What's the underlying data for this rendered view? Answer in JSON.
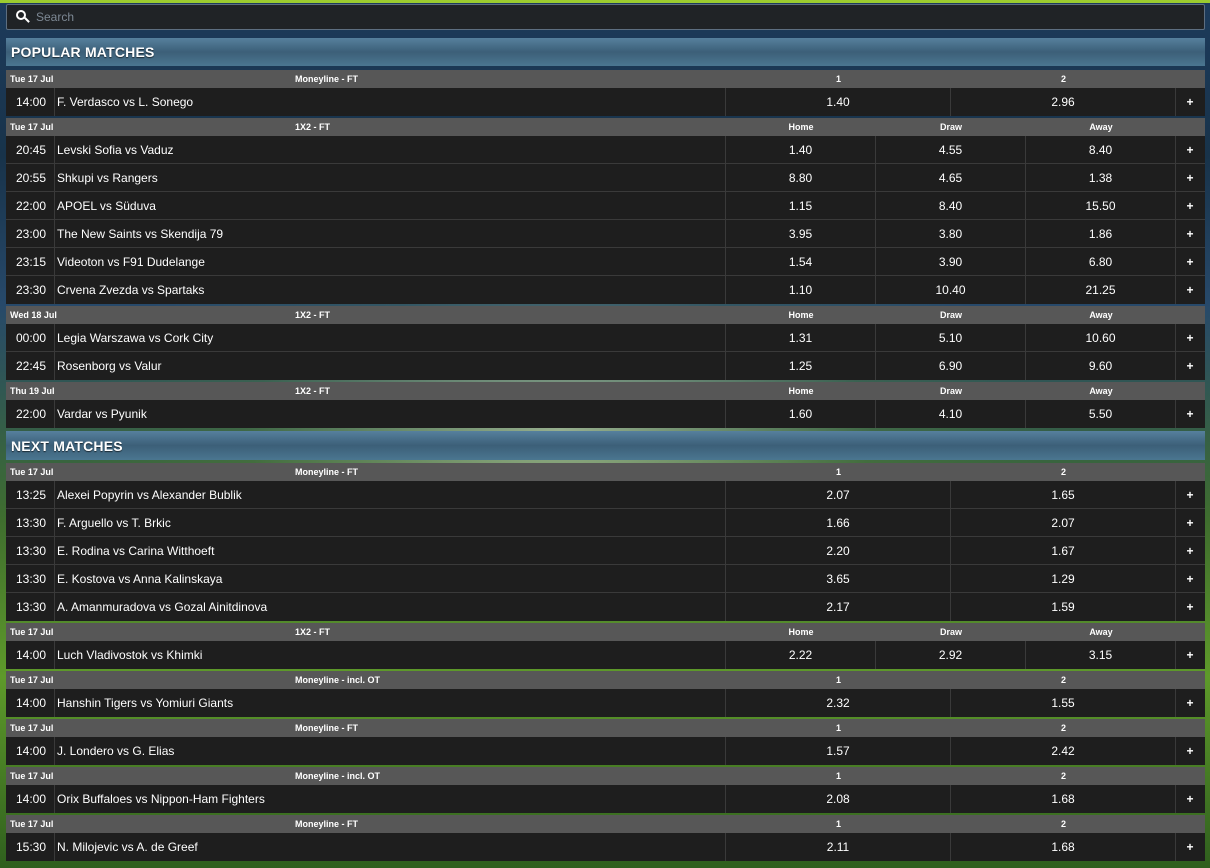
{
  "search": {
    "placeholder": "Search",
    "icon": "search-icon"
  },
  "sections": [
    {
      "title": "POPULAR MATCHES",
      "groups": [
        {
          "date": "Tue 17 Jul",
          "market": "Moneyline - FT",
          "cols": [
            "1",
            "2"
          ],
          "rows": [
            {
              "time": "14:00",
              "match": "F. Verdasco  vs  L. Sonego",
              "odds": [
                "1.40",
                "2.96"
              ]
            }
          ]
        },
        {
          "date": "Tue 17 Jul",
          "market": "1X2 - FT",
          "cols": [
            "Home",
            "Draw",
            "Away"
          ],
          "rows": [
            {
              "time": "20:45",
              "match": "Levski Sofia  vs  Vaduz",
              "odds": [
                "1.40",
                "4.55",
                "8.40"
              ]
            },
            {
              "time": "20:55",
              "match": "Shkupi  vs  Rangers",
              "odds": [
                "8.80",
                "4.65",
                "1.38"
              ]
            },
            {
              "time": "22:00",
              "match": "APOEL  vs  Süduva",
              "odds": [
                "1.15",
                "8.40",
                "15.50"
              ]
            },
            {
              "time": "23:00",
              "match": "The New Saints  vs  Skendija 79",
              "odds": [
                "3.95",
                "3.80",
                "1.86"
              ]
            },
            {
              "time": "23:15",
              "match": "Videoton  vs  F91 Dudelange",
              "odds": [
                "1.54",
                "3.90",
                "6.80"
              ]
            },
            {
              "time": "23:30",
              "match": "Crvena Zvezda  vs  Spartaks",
              "odds": [
                "1.10",
                "10.40",
                "21.25"
              ]
            }
          ]
        },
        {
          "date": "Wed 18 Jul",
          "market": "1X2 - FT",
          "cols": [
            "Home",
            "Draw",
            "Away"
          ],
          "rows": [
            {
              "time": "00:00",
              "match": "Legia Warszawa  vs  Cork City",
              "odds": [
                "1.31",
                "5.10",
                "10.60"
              ]
            },
            {
              "time": "22:45",
              "match": "Rosenborg  vs  Valur",
              "odds": [
                "1.25",
                "6.90",
                "9.60"
              ]
            }
          ]
        },
        {
          "date": "Thu 19 Jul",
          "market": "1X2 - FT",
          "cols": [
            "Home",
            "Draw",
            "Away"
          ],
          "rows": [
            {
              "time": "22:00",
              "match": "Vardar  vs  Pyunik",
              "odds": [
                "1.60",
                "4.10",
                "5.50"
              ]
            }
          ]
        }
      ]
    },
    {
      "title": "NEXT MATCHES",
      "groups": [
        {
          "date": "Tue 17 Jul",
          "market": "Moneyline - FT",
          "cols": [
            "1",
            "2"
          ],
          "rows": [
            {
              "time": "13:25",
              "match": "Alexei Popyrin  vs  Alexander Bublik",
              "odds": [
                "2.07",
                "1.65"
              ]
            },
            {
              "time": "13:30",
              "match": "F. Arguello  vs  T. Brkic",
              "odds": [
                "1.66",
                "2.07"
              ]
            },
            {
              "time": "13:30",
              "match": "E. Rodina  vs  Carina Witthoeft",
              "odds": [
                "2.20",
                "1.67"
              ]
            },
            {
              "time": "13:30",
              "match": "E. Kostova  vs  Anna Kalinskaya",
              "odds": [
                "3.65",
                "1.29"
              ]
            },
            {
              "time": "13:30",
              "match": "A. Amanmuradova  vs  Gozal Ainitdinova",
              "odds": [
                "2.17",
                "1.59"
              ]
            }
          ]
        },
        {
          "date": "Tue 17 Jul",
          "market": "1X2 - FT",
          "cols": [
            "Home",
            "Draw",
            "Away"
          ],
          "rows": [
            {
              "time": "14:00",
              "match": "Luch Vladivostok  vs  Khimki",
              "odds": [
                "2.22",
                "2.92",
                "3.15"
              ]
            }
          ]
        },
        {
          "date": "Tue 17 Jul",
          "market": "Moneyline - incl. OT",
          "cols": [
            "1",
            "2"
          ],
          "rows": [
            {
              "time": "14:00",
              "match": "Hanshin Tigers  vs  Yomiuri Giants",
              "odds": [
                "2.32",
                "1.55"
              ]
            }
          ]
        },
        {
          "date": "Tue 17 Jul",
          "market": "Moneyline - FT",
          "cols": [
            "1",
            "2"
          ],
          "rows": [
            {
              "time": "14:00",
              "match": "J. Londero  vs  G. Elias",
              "odds": [
                "1.57",
                "2.42"
              ]
            }
          ]
        },
        {
          "date": "Tue 17 Jul",
          "market": "Moneyline - incl. OT",
          "cols": [
            "1",
            "2"
          ],
          "rows": [
            {
              "time": "14:00",
              "match": "Orix Buffaloes  vs  Nippon-Ham Fighters",
              "odds": [
                "2.08",
                "1.68"
              ]
            }
          ]
        },
        {
          "date": "Tue 17 Jul",
          "market": "Moneyline - FT",
          "cols": [
            "1",
            "2"
          ],
          "rows": [
            {
              "time": "15:30",
              "match": "N. Milojevic  vs  A. de Greef",
              "odds": [
                "2.11",
                "1.68"
              ]
            }
          ]
        }
      ]
    }
  ],
  "more_label": "+"
}
